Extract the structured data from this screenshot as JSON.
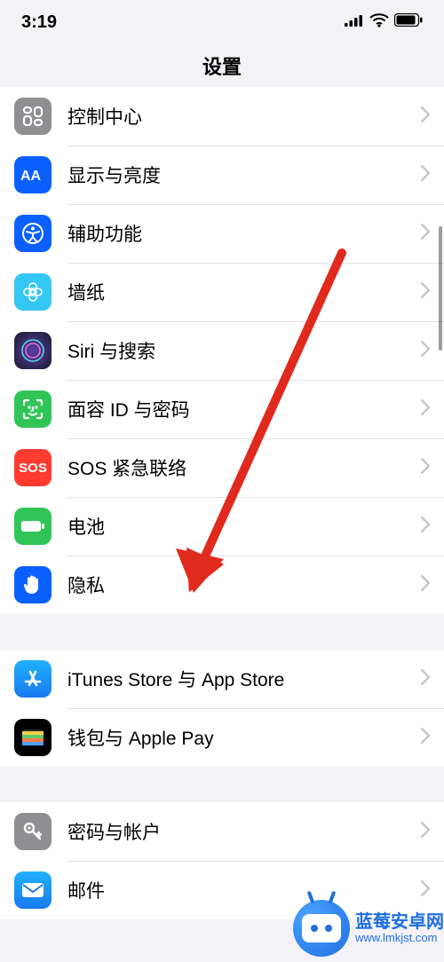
{
  "status": {
    "time": "3:19"
  },
  "nav": {
    "title": "设置"
  },
  "groups": [
    {
      "rows": [
        {
          "key": "control-center",
          "label": "控制中心"
        },
        {
          "key": "display",
          "label": "显示与亮度"
        },
        {
          "key": "accessibility",
          "label": "辅助功能"
        },
        {
          "key": "wallpaper",
          "label": "墙纸"
        },
        {
          "key": "siri",
          "label": "Siri 与搜索"
        },
        {
          "key": "faceid",
          "label": "面容 ID 与密码"
        },
        {
          "key": "sos",
          "label": "SOS 紧急联络"
        },
        {
          "key": "battery",
          "label": "电池"
        },
        {
          "key": "privacy",
          "label": "隐私"
        }
      ]
    },
    {
      "rows": [
        {
          "key": "itunes",
          "label": "iTunes Store 与 App Store"
        },
        {
          "key": "wallet",
          "label": "钱包与 Apple Pay"
        }
      ]
    },
    {
      "rows": [
        {
          "key": "passwords",
          "label": "密码与帐户"
        },
        {
          "key": "mail",
          "label": "邮件"
        }
      ]
    }
  ],
  "watermark": {
    "line1": "蓝莓安卓网",
    "line2": "www.lmkjst.com"
  }
}
